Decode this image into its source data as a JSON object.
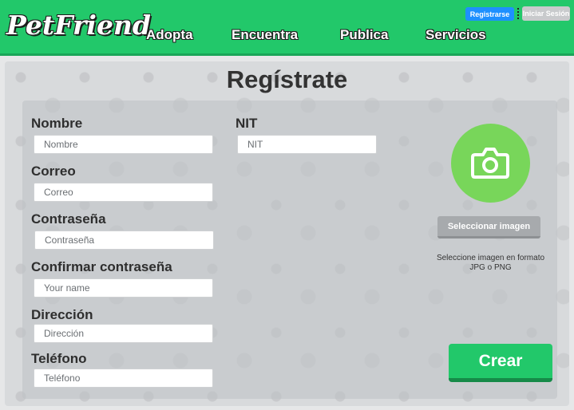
{
  "navbar": {
    "logo": "PetFriend",
    "links": [
      "Adopta",
      "Encuentra",
      "Publica",
      "Servicios"
    ],
    "register_label": "Registrarse",
    "login_label": "Iniciar Sesión"
  },
  "page": {
    "title": "Regístrate"
  },
  "form": {
    "fields": [
      {
        "label": "Nombre",
        "placeholder": "Nombre"
      },
      {
        "label": "Correo",
        "placeholder": "Correo"
      },
      {
        "label": "Contraseña",
        "placeholder": "Contraseña"
      },
      {
        "label": "Confirmar contraseña",
        "placeholder": "Your name"
      },
      {
        "label": "Dirección",
        "placeholder": "Dirección"
      },
      {
        "label": "Teléfono",
        "placeholder": "Teléfono"
      }
    ],
    "nit": {
      "label": "NIT",
      "placeholder": "NIT"
    },
    "image": {
      "icon": "camera-icon",
      "select_label": "Seleccionar imagen",
      "hint": "Seleccione imagen en formato JPG o PNG"
    },
    "create_label": "Crear"
  },
  "colors": {
    "brand_green": "#22c86a",
    "avatar_green": "#78d65a",
    "register_blue": "#1e90ff"
  }
}
